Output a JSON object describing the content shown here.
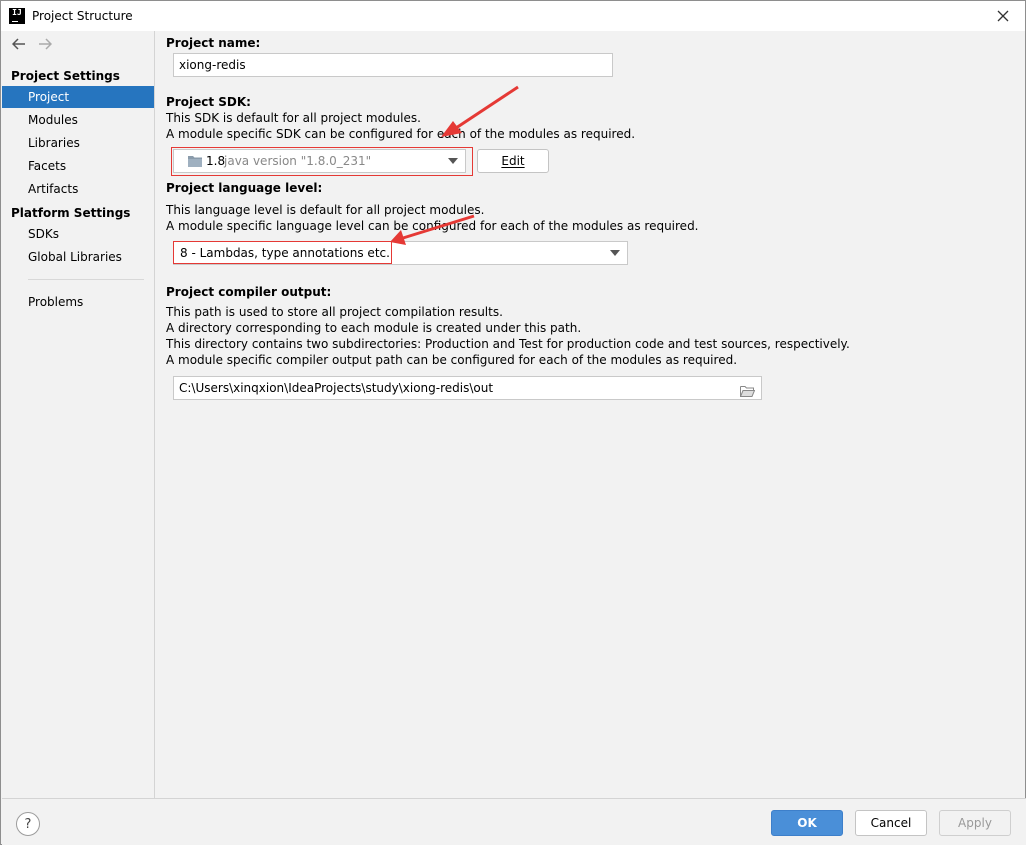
{
  "window": {
    "title": "Project Structure",
    "app_icon_text": "IJ"
  },
  "sidebar": {
    "project_settings_label": "Project Settings",
    "platform_settings_label": "Platform Settings",
    "items": [
      {
        "label": "Project"
      },
      {
        "label": "Modules"
      },
      {
        "label": "Libraries"
      },
      {
        "label": "Facets"
      },
      {
        "label": "Artifacts"
      },
      {
        "label": "SDKs"
      },
      {
        "label": "Global Libraries"
      },
      {
        "label": "Problems"
      }
    ]
  },
  "main": {
    "project_name": {
      "label": "Project name:",
      "value": "xiong-redis"
    },
    "sdk": {
      "label": "Project SDK:",
      "desc1": "This SDK is default for all project modules.",
      "desc2": "A module specific SDK can be configured for each of the modules as required.",
      "selected_version": "1.8",
      "selected_detail": "java version \"1.8.0_231\"",
      "edit_label": "Edit"
    },
    "language_level": {
      "label": "Project language level:",
      "desc1": "This language level is default for all project modules.",
      "desc2": "A module specific language level can be configured for each of the modules as required.",
      "selected": "8 - Lambdas, type annotations etc."
    },
    "compiler_output": {
      "label": "Project compiler output:",
      "desc1": "This path is used to store all project compilation results.",
      "desc2": "A directory corresponding to each module is created under this path.",
      "desc3": "This directory contains two subdirectories: Production and Test for production code and test sources, respectively.",
      "desc4": "A module specific compiler output path can be configured for each of the modules as required.",
      "path": "C:\\Users\\xinqxion\\IdeaProjects\\study\\xiong-redis\\out"
    }
  },
  "footer": {
    "help_label": "?",
    "ok_label": "OK",
    "cancel_label": "Cancel",
    "apply_label": "Apply"
  },
  "colors": {
    "selection": "#2675bf",
    "annotation_red": "#e53935"
  }
}
